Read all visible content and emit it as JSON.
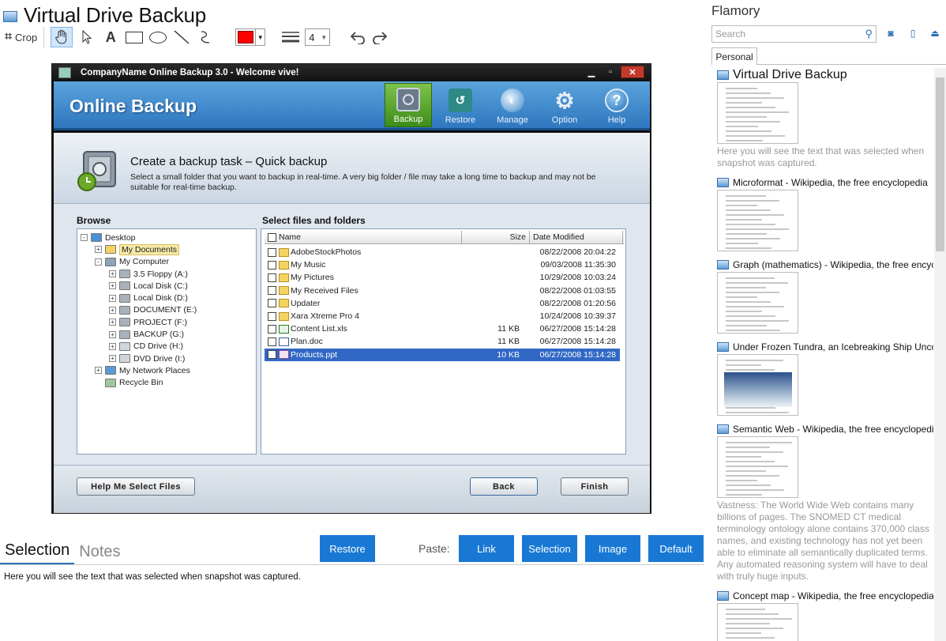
{
  "app": {
    "title": "Virtual Drive Backup",
    "crop_label": "Crop",
    "text_tool_glyph": "A",
    "line_width": "4",
    "accent_color": "#1978d4",
    "stroke_color": "#ff0000"
  },
  "shot": {
    "window_title": "CompanyName Online Backup 3.0 - Welcome vive!",
    "brand": "Online Backup",
    "nav": [
      {
        "label": "Backup",
        "icon": "safe-icon",
        "selected": true
      },
      {
        "label": "Restore",
        "icon": "restore-icon",
        "selected": false
      },
      {
        "label": "Manage",
        "icon": "manage-icon",
        "selected": false
      },
      {
        "label": "Option",
        "icon": "gear-icon",
        "selected": false
      },
      {
        "label": "Help",
        "icon": "help-icon",
        "selected": false
      }
    ],
    "heading": "Create a backup task – Quick backup",
    "description": "Select a small folder that you want to backup in real-time. A very big folder / file may take a long time to backup and may not be suitable for real-time backup.",
    "browse_label": "Browse",
    "files_label": "Select files and folders",
    "tree": [
      {
        "label": "Desktop",
        "level": 0,
        "expander": "-",
        "icon": "desktop"
      },
      {
        "label": "My Documents",
        "level": 1,
        "expander": "+",
        "icon": "folder",
        "selected": true
      },
      {
        "label": "My Computer",
        "level": 1,
        "expander": "-",
        "icon": "computer"
      },
      {
        "label": "3.5 Floppy (A:)",
        "level": 2,
        "expander": "+",
        "icon": "drive"
      },
      {
        "label": "Local Disk (C:)",
        "level": 2,
        "expander": "+",
        "icon": "drive"
      },
      {
        "label": "Local Disk (D:)",
        "level": 2,
        "expander": "+",
        "icon": "drive"
      },
      {
        "label": "DOCUMENT (E:)",
        "level": 2,
        "expander": "+",
        "icon": "drive"
      },
      {
        "label": "PROJECT (F:)",
        "level": 2,
        "expander": "+",
        "icon": "drive"
      },
      {
        "label": "BACKUP (G:)",
        "level": 2,
        "expander": "+",
        "icon": "drive"
      },
      {
        "label": "CD Drive (H:)",
        "level": 2,
        "expander": "+",
        "icon": "disc"
      },
      {
        "label": "DVD Drive (I:)",
        "level": 2,
        "expander": "+",
        "icon": "disc"
      },
      {
        "label": "My Network Places",
        "level": 1,
        "expander": "+",
        "icon": "network"
      },
      {
        "label": "Recycle Bin",
        "level": 1,
        "expander": "",
        "icon": "recycle"
      }
    ],
    "columns": {
      "name": "Name",
      "size": "Size",
      "date": "Date Modified"
    },
    "files": [
      {
        "name": "AdobeStockPhotos",
        "size": "",
        "date": "08/22/2008 20:04:22",
        "type": "folder"
      },
      {
        "name": "My Music",
        "size": "",
        "date": "09/03/2008 11:35:30",
        "type": "folder"
      },
      {
        "name": "My Pictures",
        "size": "",
        "date": "10/29/2008 10:03:24",
        "type": "folder"
      },
      {
        "name": "My Received Files",
        "size": "",
        "date": "08/22/2008 01:03:55",
        "type": "folder"
      },
      {
        "name": "Updater",
        "size": "",
        "date": "08/22/2008 01:20:56",
        "type": "folder"
      },
      {
        "name": "Xara Xtreme Pro 4",
        "size": "",
        "date": "10/24/2008 10:39:37",
        "type": "folder"
      },
      {
        "name": "Content List.xls",
        "size": "11 KB",
        "date": "06/27/2008 15:14:28",
        "type": "xls"
      },
      {
        "name": "Plan.doc",
        "size": "11 KB",
        "date": "06/27/2008 15:14:28",
        "type": "doc"
      },
      {
        "name": "Products.ppt",
        "size": "10 KB",
        "date": "06/27/2008 15:14:28",
        "type": "ppt",
        "selected": true
      }
    ],
    "help_button": "Help Me Select Files",
    "back_button": "Back",
    "finish_button": "Finish"
  },
  "bottom": {
    "tab_selection": "Selection",
    "tab_notes": "Notes",
    "restore_button": "Restore",
    "paste_label": "Paste:",
    "paste_buttons": [
      "Link",
      "Selection",
      "Image",
      "Default"
    ],
    "selection_text": "Here you will see the text that was selected when snapshot was captured."
  },
  "sidebar": {
    "title": "Flamory",
    "search_placeholder": "Search",
    "tab": "Personal",
    "snapshots": [
      {
        "title": "Virtual Drive Backup",
        "desc": "Here you will see the text that was selected when snapshot was captured."
      },
      {
        "title": "Microformat - Wikipedia, the free encyclopedia",
        "desc": ""
      },
      {
        "title": "Graph (mathematics) - Wikipedia, the free encyclopedia",
        "desc": ""
      },
      {
        "title": "Under Frozen Tundra, an Icebreaking Ship Uncovers",
        "desc": ""
      },
      {
        "title": "Semantic Web - Wikipedia, the free encyclopedia",
        "desc": "Vastness: The World Wide Web contains many billions of pages. The SNOMED CT medical terminology ontology alone contains 370,000 class names, and existing technology has not yet been able to eliminate all semantically duplicated terms. Any automated reasoning system will have to deal with truly huge inputs."
      },
      {
        "title": "Concept map - Wikipedia, the free encyclopedia",
        "desc": ""
      }
    ]
  }
}
